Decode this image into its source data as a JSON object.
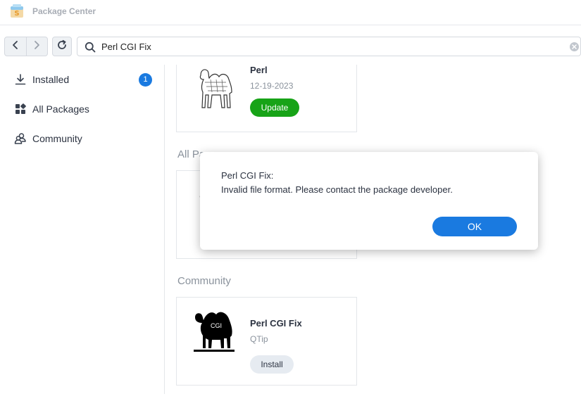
{
  "window": {
    "title": "Package Center"
  },
  "toolbar": {
    "back_icon": "chevron-left-icon",
    "forward_icon": "chevron-right-icon",
    "refresh_icon": "refresh-icon",
    "search": {
      "value": "Perl CGI Fix",
      "placeholder": ""
    }
  },
  "sidebar": {
    "items": [
      {
        "label": "Installed",
        "icon": "download-icon",
        "badge": "1"
      },
      {
        "label": "All Packages",
        "icon": "grid-icon"
      },
      {
        "label": "Community",
        "icon": "community-icon"
      }
    ]
  },
  "installed": {
    "card": {
      "name": "Perl",
      "date": "12-19-2023",
      "button": "Update"
    }
  },
  "all_packages": {
    "section_title": "All Pa"
  },
  "community": {
    "section_title": "Community",
    "card": {
      "name": "Perl CGI Fix",
      "author": "QTip",
      "button": "Install",
      "logo_text": "CGI"
    }
  },
  "dialog": {
    "title": "Perl CGI Fix:",
    "message": "Invalid file format. Please contact the package developer.",
    "ok_label": "OK"
  },
  "colors": {
    "accent": "#1a7ae0",
    "update": "#17a317",
    "badge": "#1a7ae0"
  }
}
